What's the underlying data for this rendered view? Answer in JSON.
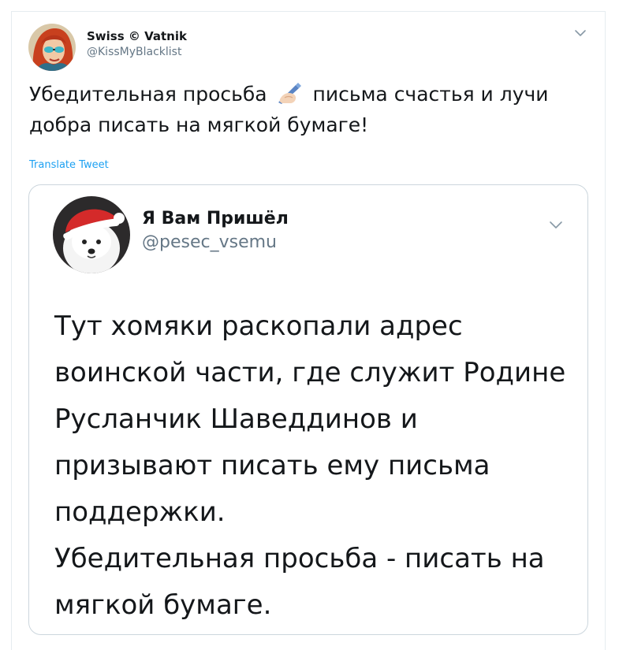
{
  "tweet": {
    "author": {
      "display_name": "Swiss © Vatnik",
      "handle": "@KissMyBlacklist",
      "avatar_icon": "red-haired-woman-avatar"
    },
    "text_before_emoji": "Убедительная просьба ",
    "emoji_icon": "writing-hand-emoji",
    "text_after_emoji": " письма счастья и лучи добра писать на мягкой бумаге!",
    "translate_label": "Translate Tweet",
    "menu_icon": "chevron-down-icon"
  },
  "quoted_tweet": {
    "author": {
      "display_name": "Я Вам Пришёл",
      "handle": "@pesec_vsemu",
      "avatar_icon": "white-dog-santa-hat-avatar"
    },
    "paragraphs": [
      "Тут хомяки раскопали адрес воинской части, где служит Родине Русланчик Шаведдинов и призывают писать ему письма поддержки.",
      "Убедительная просьба - писать на мягкой бумаге."
    ],
    "menu_icon": "chevron-down-icon"
  },
  "colors": {
    "text": "#14171a",
    "secondary": "#657786",
    "link": "#1da1f2",
    "border": "#ccd6dd"
  }
}
